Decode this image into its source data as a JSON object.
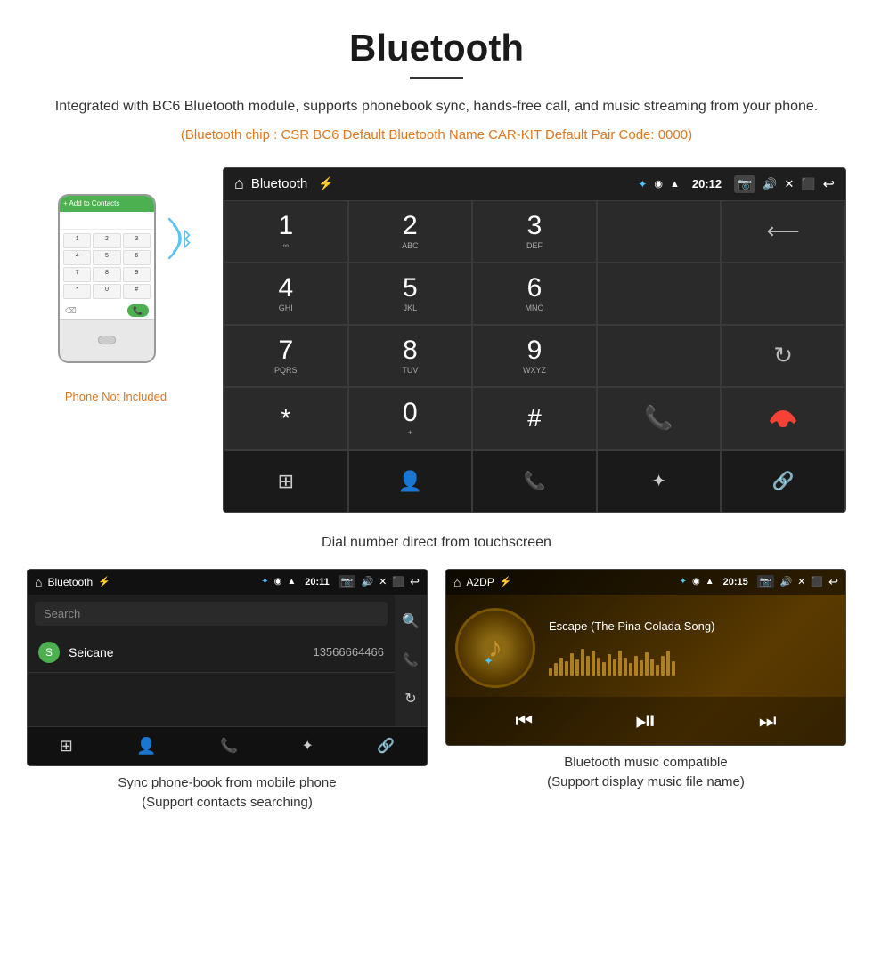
{
  "page": {
    "title": "Bluetooth",
    "description": "Integrated with BC6 Bluetooth module, supports phonebook sync, hands-free call, and music streaming from your phone.",
    "specs": "(Bluetooth chip : CSR BC6    Default Bluetooth Name CAR-KIT    Default Pair Code: 0000)",
    "main_caption": "Dial number direct from touchscreen",
    "bottom_caption_left": "Sync phone-book from mobile phone\n(Support contacts searching)",
    "bottom_caption_right": "Bluetooth music compatible\n(Support display music file name)"
  },
  "car_screen": {
    "statusbar": {
      "title": "Bluetooth",
      "time": "20:12",
      "usb_icon": "⚡",
      "bt_icon": "✦",
      "location_icon": "◉",
      "wifi_icon": "▲",
      "camera_icon": "📷",
      "volume_icon": "🔊",
      "x_icon": "✕",
      "rect_icon": "⬜",
      "back_icon": "↩"
    },
    "dialpad": [
      {
        "num": "1",
        "letters": "∞",
        "col": 1
      },
      {
        "num": "2",
        "letters": "ABC",
        "col": 2
      },
      {
        "num": "3",
        "letters": "DEF",
        "col": 3
      },
      {
        "num": "",
        "letters": "",
        "col": 4
      },
      {
        "num": "⌫",
        "letters": "",
        "col": 5
      },
      {
        "num": "4",
        "letters": "GHI",
        "col": 1
      },
      {
        "num": "5",
        "letters": "JKL",
        "col": 2
      },
      {
        "num": "6",
        "letters": "MNO",
        "col": 3
      },
      {
        "num": "",
        "letters": "",
        "col": 4
      },
      {
        "num": "",
        "letters": "",
        "col": 5
      },
      {
        "num": "7",
        "letters": "PQRS",
        "col": 1
      },
      {
        "num": "8",
        "letters": "TUV",
        "col": 2
      },
      {
        "num": "9",
        "letters": "WXYZ",
        "col": 3
      },
      {
        "num": "",
        "letters": "",
        "col": 4
      },
      {
        "num": "↺",
        "letters": "",
        "col": 5
      },
      {
        "num": "*",
        "letters": "",
        "col": 1
      },
      {
        "num": "0",
        "letters": "+",
        "col": 2
      },
      {
        "num": "#",
        "letters": "",
        "col": 3
      },
      {
        "num": "📞",
        "letters": "",
        "col": 4
      },
      {
        "num": "📞",
        "letters": "",
        "col": 5
      }
    ],
    "bottom_nav": [
      "⊞",
      "👤",
      "📞",
      "✦",
      "🔗"
    ]
  },
  "phonebook_screen": {
    "statusbar": {
      "title": "Bluetooth",
      "time": "20:11"
    },
    "search_placeholder": "Search",
    "contact": {
      "letter": "S",
      "name": "Seicane",
      "number": "13566664466"
    },
    "right_icons": [
      "🔍",
      "📞",
      "↺"
    ],
    "bottom_nav": [
      "⊞",
      "👤",
      "📞",
      "✦",
      "🔗"
    ]
  },
  "music_screen": {
    "statusbar": {
      "title": "A2DP",
      "time": "20:15"
    },
    "song_title": "Escape (The Pina Colada Song)",
    "viz_bars": [
      8,
      14,
      20,
      16,
      25,
      18,
      30,
      22,
      28,
      20,
      15,
      24,
      18,
      28,
      20,
      14,
      22,
      17,
      26,
      19,
      12,
      22,
      28,
      16
    ],
    "controls": {
      "prev": "⏮",
      "play_pause": "⏯",
      "next": "⏭"
    }
  },
  "phone_area": {
    "not_included": "Phone Not Included",
    "keys": [
      "1",
      "2",
      "3",
      "4",
      "5",
      "6",
      "7",
      "8",
      "9",
      "*",
      "0",
      "#"
    ]
  }
}
